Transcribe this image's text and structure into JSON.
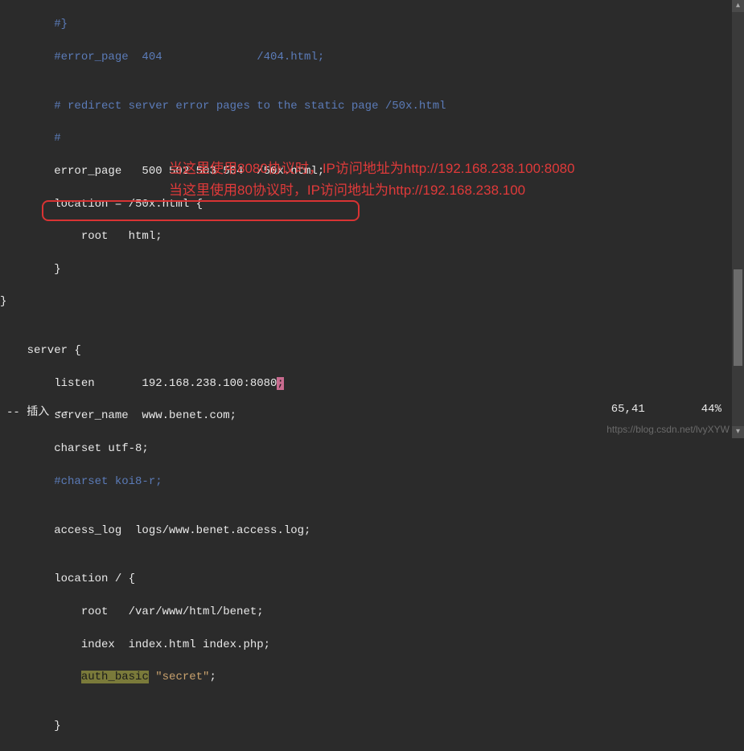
{
  "code": {
    "l1": "        #}",
    "l2_a": "        #error_page  404              /404.html;",
    "l3": "",
    "l4": "        # redirect server error pages to the static page /50x.html",
    "l5": "        #",
    "l6": "        error_page   500 502 503 504  /50x.html;",
    "l7": "        location = /50x.html {",
    "l8": "            root   html;",
    "l9": "        }",
    "l10": "}",
    "l11": "",
    "l12": "    server {",
    "l13_a": "        listen       192.168.238.100:8080",
    "l13_b": ";",
    "l14": "        server_name  www.benet.com;",
    "l15": "        charset utf-8;",
    "l16": "        #charset koi8-r;",
    "l17": "",
    "l18": "        access_log  logs/www.benet.access.log;",
    "l19": "",
    "l20": "        location / {",
    "l21": "            root   /var/www/html/benet;",
    "l22": "            index  index.html index.php;",
    "l23_a": "            ",
    "l23_b": "auth_basic",
    "l23_c": " ",
    "l23_d": "\"secret\"",
    "l23_e": ";",
    "l24": "",
    "l25": "        }"
  },
  "annotations": {
    "line1": "当这里使用8080协议时，IP访问地址为http://192.168.238.100:8080",
    "line2": "当这里使用80协议时，IP访问地址为http://192.168.238.100"
  },
  "status": {
    "mode": "-- 插入 --",
    "position": "65,41",
    "percent": "44%"
  },
  "watermark": "https://blog.csdn.net/lvyXYW"
}
